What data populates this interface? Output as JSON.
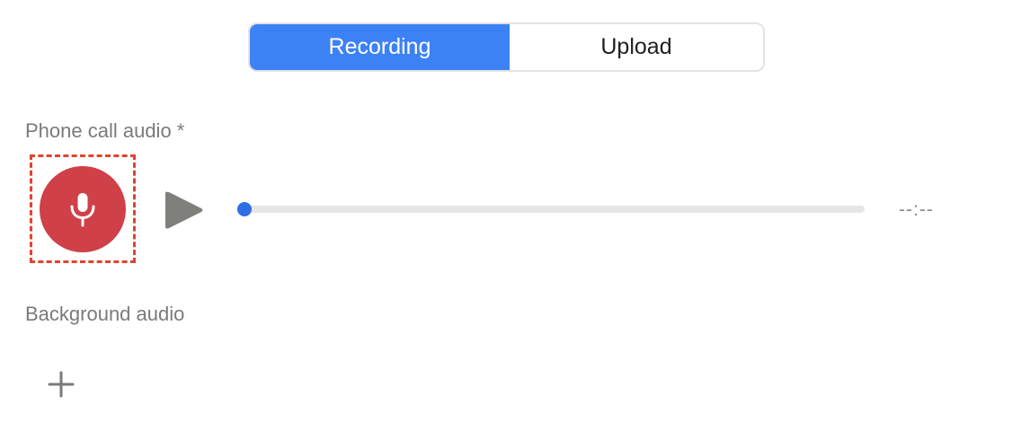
{
  "tabs": {
    "recording": "Recording",
    "upload": "Upload",
    "active": "Recording"
  },
  "phone_call": {
    "label": "Phone call audio *",
    "mic_icon": "microphone-icon",
    "play_icon": "play-icon",
    "progress_fraction": 0,
    "time": "--:--"
  },
  "background": {
    "label": "Background audio",
    "add_icon": "plus-icon"
  },
  "colors": {
    "accent": "#3d82f5",
    "mic": "#cf4049",
    "highlight": "#e0432f",
    "play": "#7f807c",
    "label": "#7a7a7a"
  }
}
